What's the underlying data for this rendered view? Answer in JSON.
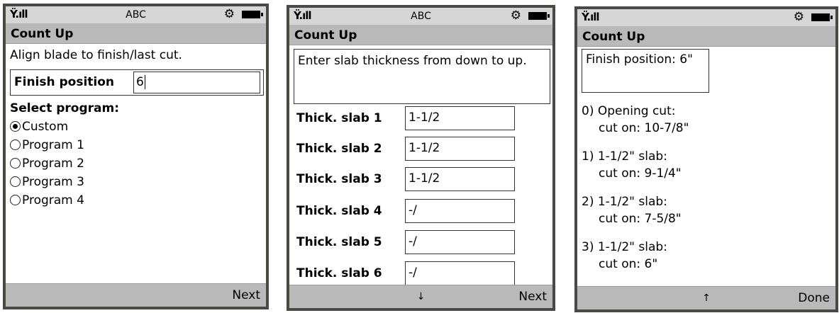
{
  "status": {
    "signal": "Ÿ.ıll",
    "input_mode": "ABC",
    "icons": [
      "signal-icon",
      "gear-icon",
      "battery-icon"
    ]
  },
  "screens": [
    {
      "title": "Count Up",
      "instruction": "Align blade to finish/last cut.",
      "finish_label": "Finish position",
      "finish_value": "6",
      "select_label": "Select program:",
      "options": [
        "Custom",
        "Program 1",
        "Program 2",
        "Program 3",
        "Program 4"
      ],
      "selected_option": "Custom",
      "right_softkey": "Next"
    },
    {
      "title": "Count Up",
      "instruction": "Enter slab thickness from down to up.",
      "slabs": [
        {
          "label": "Thick. slab 1",
          "value": "1-1/2"
        },
        {
          "label": "Thick. slab 2",
          "value": "1-1/2"
        },
        {
          "label": "Thick. slab 3",
          "value": "1-1/2"
        },
        {
          "label": "Thick. slab 4",
          "value": "-/"
        },
        {
          "label": "Thick. slab 5",
          "value": "-/"
        },
        {
          "label": "Thick. slab 6",
          "value": "-/"
        }
      ],
      "center_softkey": "↓",
      "right_softkey": "Next"
    },
    {
      "title": "Count Up",
      "finish_summary": "Finish position: 6\"",
      "results": [
        {
          "line1": "0) Opening cut:",
          "line2": "cut on: 10-7/8\""
        },
        {
          "line1": "1) 1-1/2\" slab:",
          "line2": "cut on: 9-1/4\""
        },
        {
          "line1": "2) 1-1/2\" slab:",
          "line2": "cut on: 7-5/8\""
        },
        {
          "line1": "3) 1-1/2\" slab:",
          "line2": "cut on: 6\""
        }
      ],
      "center_softkey": "↑",
      "right_softkey": "Done"
    }
  ]
}
